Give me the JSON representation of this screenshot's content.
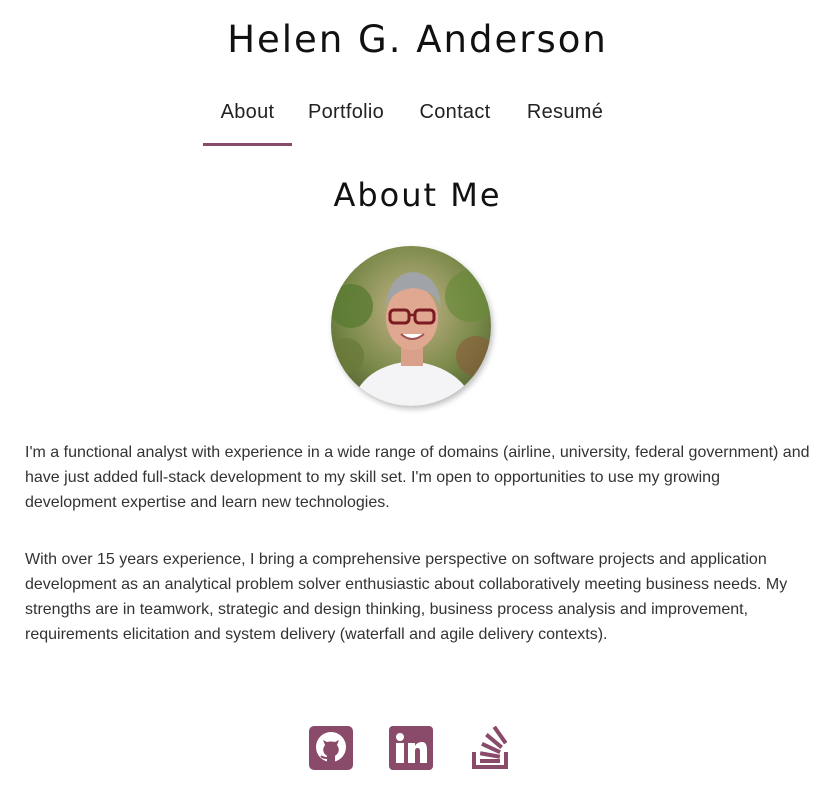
{
  "header": {
    "title": "Helen G. Anderson"
  },
  "nav": {
    "items": [
      {
        "label": "About",
        "active": true
      },
      {
        "label": "Portfolio",
        "active": false
      },
      {
        "label": "Contact",
        "active": false
      },
      {
        "label": "Resumé",
        "active": false
      }
    ]
  },
  "about": {
    "heading": "About Me",
    "paragraphs": [
      "I'm a functional analyst with experience in a wide range of domains (airline, university, federal government) and have just added full-stack development to my skill set. I'm open to opportunities to use my growing development expertise and learn new technologies.",
      "With over 15 years experience, I bring a comprehensive perspective on software projects and application development as an analytical problem solver enthusiastic about collaboratively meeting business needs. My strengths are in teamwork, strategic and design thinking, business process analysis and improvement, requirements elicitation and system delivery (waterfall and agile delivery contexts)."
    ]
  },
  "social": {
    "icons": [
      "github-icon",
      "linkedin-icon",
      "stackoverflow-icon"
    ]
  },
  "colors": {
    "accent": "#8a4a6a",
    "text": "#333333"
  }
}
